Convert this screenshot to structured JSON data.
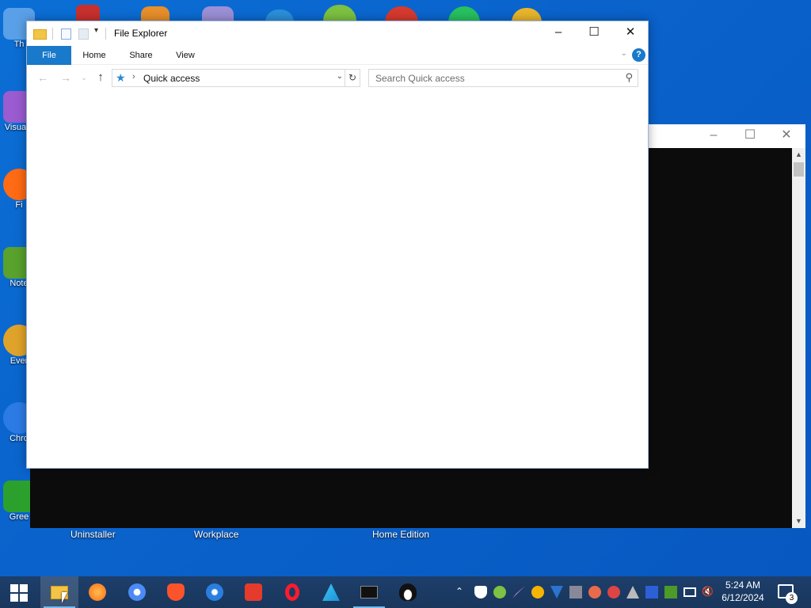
{
  "desktop": {
    "icons": [
      {
        "label": "Th",
        "color": "#5aa0e8"
      },
      {
        "label": "Visua 2",
        "color": "#9b5bd1"
      },
      {
        "label": "Fi",
        "color": "#ff6a14"
      },
      {
        "label": "Note",
        "color": "#58a22d"
      },
      {
        "label": "Ever",
        "color": "#e0a32a"
      },
      {
        "label": "Chro",
        "color": "#2c7be5"
      },
      {
        "label": "Gree",
        "color": "#2ca02c"
      }
    ],
    "bottom_labels": [
      "Uninstaller",
      "Workplace",
      "Home Edition"
    ]
  },
  "explorer": {
    "title": "File Explorer",
    "tabs": [
      "File",
      "Home",
      "Share",
      "View"
    ],
    "address": "Quick access",
    "search_placeholder": "Search Quick access",
    "help": "?",
    "accent": "#1979ca"
  },
  "terminal": {
    "background": "#0c0c0c"
  },
  "taskbar": {
    "apps": [
      {
        "name": "file-explorer",
        "active": true
      },
      {
        "name": "firefox"
      },
      {
        "name": "chromium"
      },
      {
        "name": "brave"
      },
      {
        "name": "ie-blue"
      },
      {
        "name": "wps"
      },
      {
        "name": "opera"
      },
      {
        "name": "vs-code"
      },
      {
        "name": "terminal",
        "running": true
      },
      {
        "name": "linux"
      }
    ],
    "time": "5:24 AM",
    "date": "6/12/2024",
    "notification_count": "3"
  }
}
